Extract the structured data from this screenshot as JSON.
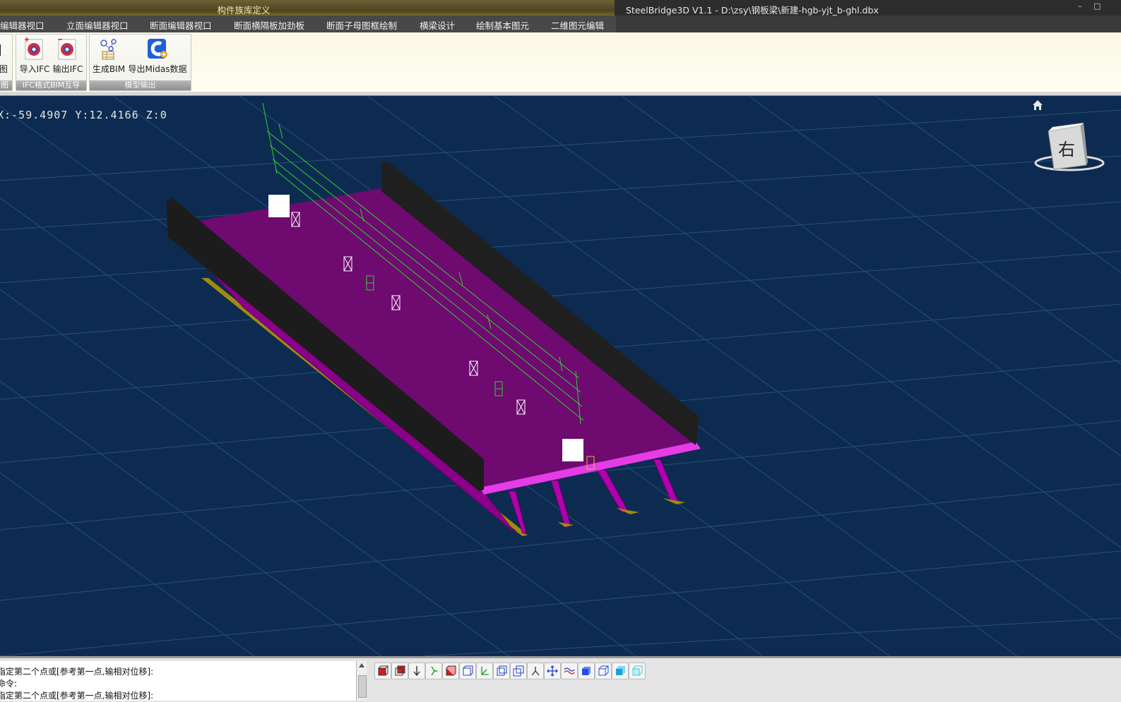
{
  "window": {
    "context_title": "构件族库定义",
    "app_title": "SteelBridge3D V1.1 - D:\\zsy\\钢板梁\\新建-hgb-yjt_b-ghl.dbx",
    "minimize_label": "–",
    "maximize_label": "□"
  },
  "tabs": [
    {
      "label": "编辑器视口"
    },
    {
      "label": "立面编辑器视口"
    },
    {
      "label": "断面编辑器视口"
    },
    {
      "label": "断面横隔板加劲板"
    },
    {
      "label": "断面子母图框绘制"
    },
    {
      "label": "横梁设计"
    },
    {
      "label": "绘制基本图元"
    },
    {
      "label": "二维图元编辑"
    }
  ],
  "ribbon": {
    "partial_group": {
      "button_label": "图",
      "group_label": "图"
    },
    "group_ifc": {
      "label": "IFC格式BIM互导",
      "buttons": [
        {
          "label": "导入IFC",
          "icon": "import-ifc-icon"
        },
        {
          "label": "输出IFC",
          "icon": "export-ifc-icon"
        }
      ]
    },
    "group_model": {
      "label": "模型输出",
      "buttons": [
        {
          "label": "生成BIM",
          "icon": "generate-bim-icon"
        },
        {
          "label": "导出Midas数据",
          "icon": "midas-export-icon"
        }
      ]
    }
  },
  "viewport": {
    "coordinate_readout": "X:-59.4907 Y:12.4166 Z:0",
    "viewcube_label": "右",
    "colors": {
      "background": "#0d2b50",
      "grid": "#27507a",
      "deck": "#6e0a70",
      "barrier": "#1c1c1c",
      "girder": "#c010c0",
      "flange": "#a08a10",
      "annotation": "#2fd22f"
    }
  },
  "command": {
    "lines": [
      "指定第二个点或[参考第一点,输相对位移]:",
      "命令:",
      "指定第二个点或[参考第一点,输相对位移]:"
    ]
  },
  "toolbar": {
    "icons": [
      "front-view-icon",
      "back-view-icon",
      "top-view-icon",
      "bottom-view-icon",
      "left-view-icon",
      "right-view-icon",
      "axis-view-icon",
      "iso-view-sw-icon",
      "iso-view-se-icon",
      "person-view-icon",
      "pan-icon",
      "wave-icon",
      "solid-icon",
      "wire-cube-icon",
      "shaded-icon",
      "xray-icon"
    ]
  }
}
